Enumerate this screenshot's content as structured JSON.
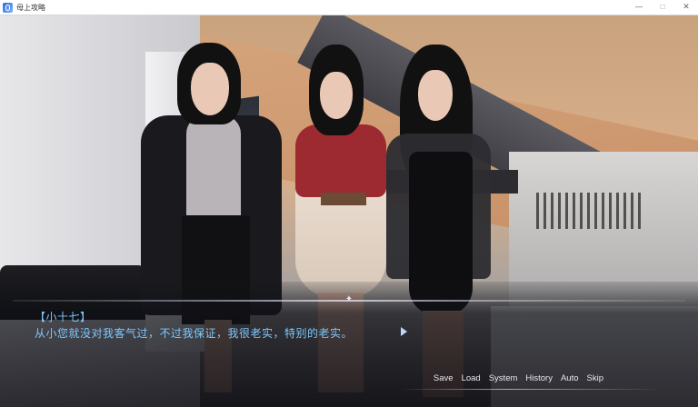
{
  "window": {
    "title": "母上攻略",
    "icon": "app-logo-icon",
    "controls": {
      "minimize": "—",
      "maximize": "☐",
      "close": "✕"
    }
  },
  "dialogue": {
    "speaker": "【小十七】",
    "text": "从小您就没对我客气过，不过我保证，我很老实，特别的老实。",
    "next_icon": "play-arrow-icon"
  },
  "menu": {
    "save": "Save",
    "load": "Load",
    "system": "System",
    "history": "History",
    "auto": "Auto",
    "skip": "Skip"
  },
  "colors": {
    "dialogue_text": "#7ec8ff",
    "menu_text": "#e8e8f0"
  }
}
